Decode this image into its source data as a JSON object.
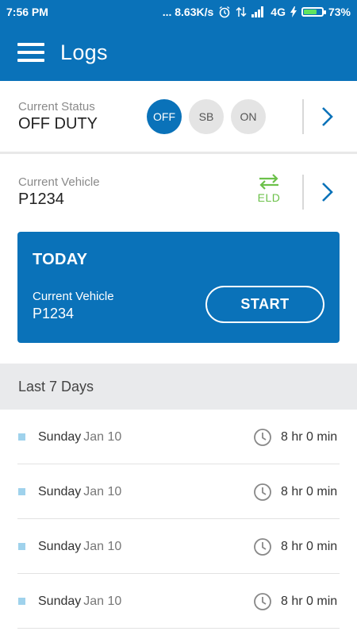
{
  "status_bar": {
    "time": "7:56 PM",
    "network_speed": "... 8.63K/s",
    "network_type": "4G",
    "battery_percent": "73%",
    "battery_level": 0.73
  },
  "app_bar": {
    "title": "Logs",
    "menu_icon": "hamburger-menu-icon"
  },
  "current_status": {
    "label": "Current Status",
    "value": "OFF DUTY",
    "buttons": [
      "OFF",
      "SB",
      "ON"
    ],
    "active": "OFF"
  },
  "current_vehicle": {
    "label": "Current Vehicle",
    "value": "P1234",
    "eld_label": "ELD"
  },
  "today": {
    "title": "TODAY",
    "vehicle_label": "Current Vehicle",
    "vehicle_value": "P1234",
    "start_label": "START"
  },
  "last_days": {
    "header": "Last 7 Days",
    "items": [
      {
        "day": "Sunday",
        "date": "Jan 10",
        "duration": "8 hr 0 min"
      },
      {
        "day": "Sunday",
        "date": "Jan 10",
        "duration": "8 hr 0 min"
      },
      {
        "day": "Sunday",
        "date": "Jan 10",
        "duration": "8 hr 0 min"
      },
      {
        "day": "Sunday",
        "date": "Jan 10",
        "duration": "8 hr 0 min"
      }
    ]
  },
  "colors": {
    "primary": "#0a72b9",
    "eld_green": "#6cc14a",
    "bullet": "#9fd2ec"
  }
}
